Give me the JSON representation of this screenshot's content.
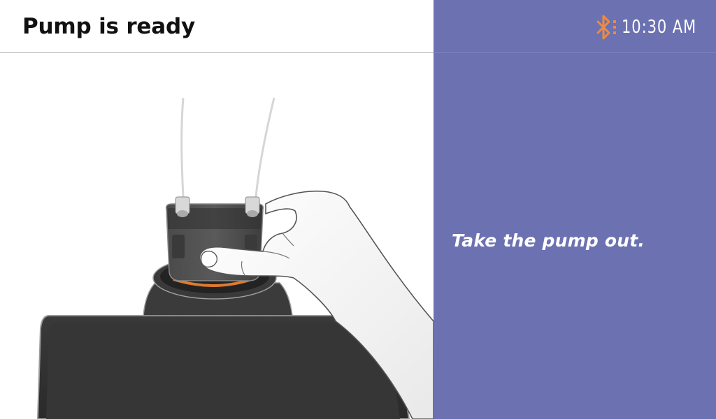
{
  "header": {
    "title": "Pump is ready"
  },
  "status_bar": {
    "bluetooth_icon": "bluetooth-icon",
    "bluetooth_color": "#f08a3c",
    "time": "10:30 AM"
  },
  "instruction": {
    "text": "Take the pump out."
  },
  "illustration": {
    "icon": "pump-removal-illustration"
  },
  "colors": {
    "panel_background": "#6b71b1",
    "accent": "#f08a3c",
    "text_dark": "#111111",
    "text_light": "#ffffff"
  }
}
